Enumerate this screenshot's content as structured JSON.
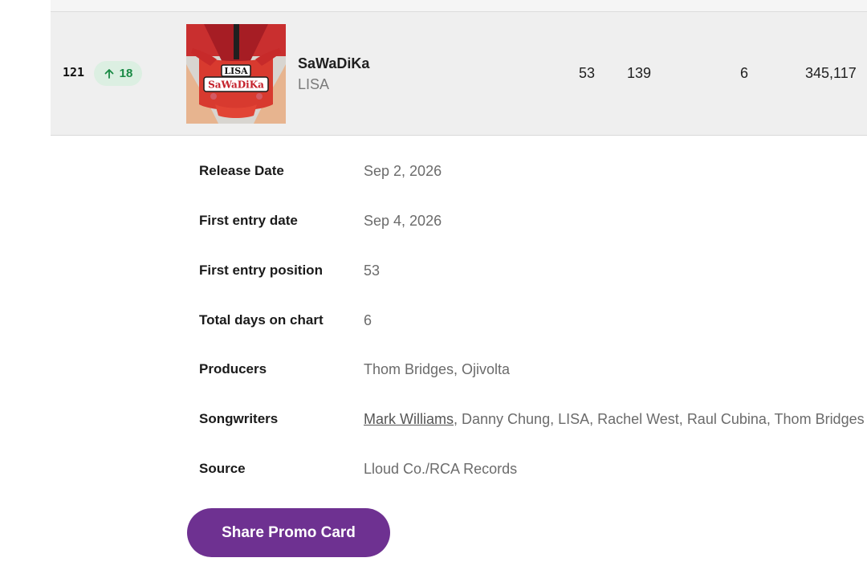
{
  "entry": {
    "rank": "121",
    "movement": "18",
    "movement_icon": "arrow-up-icon",
    "title": "SaWaDiKa",
    "artist": "LISA",
    "cover_text_top": "LISA",
    "cover_text_main": "SaWaDiKa",
    "stats": [
      "53",
      "139",
      "6",
      "345,117"
    ]
  },
  "details": [
    {
      "label": "Release Date",
      "value": "Sep 2, 2026"
    },
    {
      "label": "First entry date",
      "value": "Sep 4, 2026"
    },
    {
      "label": "First entry position",
      "value": "53"
    },
    {
      "label": "Total days on chart",
      "value": "6"
    },
    {
      "label": "Producers",
      "value": "Thom Bridges, Ojivolta"
    },
    {
      "label": "Songwriters",
      "link": "Mark Williams",
      "value": ", Danny Chung, LISA, Rachel West, Raul Cubina, Thom Bridges"
    },
    {
      "label": "Source",
      "value": "Lloud Co./RCA Records"
    }
  ],
  "share_button": {
    "label": "Share Promo Card"
  },
  "colors": {
    "row_background": "#efefef",
    "badge_background": "#dcefe2",
    "badge_text": "#1a8a45",
    "button_background": "#6e3191"
  }
}
